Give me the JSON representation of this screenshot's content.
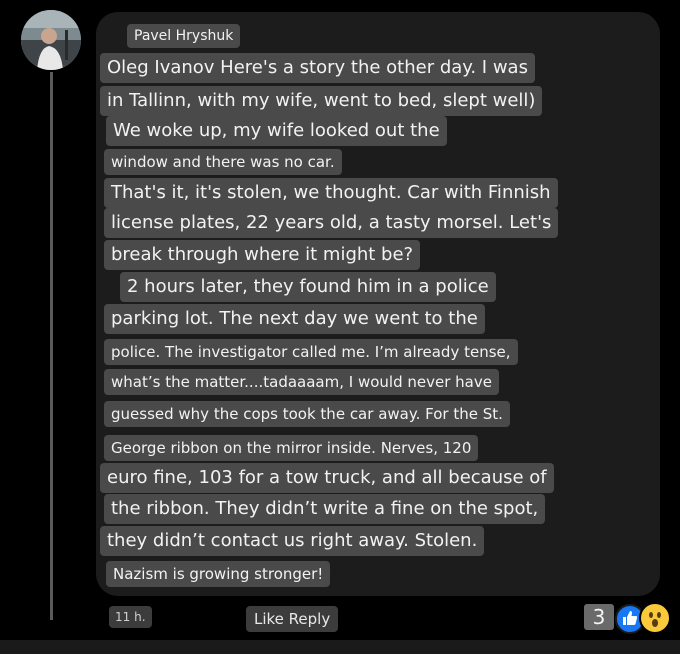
{
  "comment": {
    "author": "Pavel Hryshuk",
    "lines": [
      "Oleg Ivanov Here's a story the other day. I was",
      "in Tallinn, with my wife, went to bed, slept well)",
      "We woke up, my wife looked out the",
      "window and there was no car.",
      "That's it, it's stolen, we thought. Car with Finnish",
      "license plates, 22 years old, a tasty morsel. Let's",
      "break through where it might be?",
      "2 hours later, they found him in a police",
      "parking lot. The next day we went to the",
      "police. The investigator called me. I’m already tense,",
      "what’s the matter....tadaaaam, I would never have",
      "guessed why the cops took the car away. For the St.",
      "George ribbon on the mirror inside. Nerves, 120",
      "euro fine, 103 for a tow truck, and all because of",
      "the ribbon. They didn’t write a fine on the spot,",
      "they didn’t contact us right away. Stolen.",
      "Nazism is growing stronger!"
    ],
    "time": "11 h.",
    "actions_label": "Like Reply",
    "reaction_count": "3",
    "reaction_icons": [
      "like-icon",
      "wow-icon"
    ]
  },
  "colors": {
    "background": "#000000",
    "bubble": "#1c1c1c",
    "text_highlight": "#4a4a4a",
    "like_blue": "#1877f2",
    "wow_yellow": "#f7c93b"
  }
}
